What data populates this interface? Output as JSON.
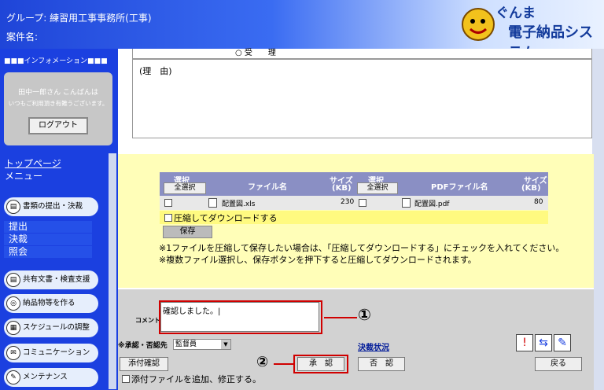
{
  "header": {
    "group": "グループ: 練習用工事事務所(工事)",
    "case": "案件名:",
    "logo_small": "ぐんま",
    "logo_big": "電子納品システム"
  },
  "sidebar": {
    "info_title": "■■■インフォメーション■■■",
    "user_greeting": "田中一郎さん こんばんは",
    "thanks": "いつもご利用頂き有難うございます。",
    "logout": "ログアウト",
    "top_link": "トップページ",
    "menu_label": "メニュー",
    "items": [
      {
        "label": "書類の提出・決裁"
      },
      {
        "label": "共有文書・検査支援"
      },
      {
        "label": "納品物等を作る"
      },
      {
        "label": "スケジュールの調整"
      },
      {
        "label": "コミュニケーション"
      },
      {
        "label": "メンテナンス"
      }
    ],
    "subitems": [
      "提出",
      "決裁",
      "照会"
    ]
  },
  "main": {
    "approve_option": "○ 受　　理",
    "reason_label": "(理　由)"
  },
  "files": {
    "headers": {
      "select": "選択",
      "select_all": "全選択",
      "file_name": "ファイル名",
      "size": "サイズ",
      "size_unit": "(KB)",
      "select2": "選択",
      "select_all2": "全選択",
      "pdf_name": "PDFファイル名",
      "size2": "サイズ",
      "size_unit2": "(KB)"
    },
    "row": {
      "file": "配置図.xls",
      "size": "230",
      "pdf": "配置図.pdf",
      "pdf_size": "80"
    },
    "zip_label": "圧縮してダウンロードする",
    "save": "保存",
    "note1": "※1ファイルを圧縮して保存したい場合は、「圧縮してダウンロードする」にチェックを入れてください。",
    "note2": "※複数ファイル選択し、保存ボタンを押下すると圧縮してダウンロードされます。"
  },
  "bottom": {
    "comment_label": "コメント",
    "comment_value": "確認しました。|",
    "callout1": "①",
    "callout2": "②",
    "approver_label": "※承認・否認先",
    "approver_value": "監督員",
    "status_link": "決裁状況",
    "attach_confirm": "添付確認",
    "approve": "承　認",
    "reject": "否　認",
    "back": "戻る",
    "attach_modify": "添付ファイルを追加、修正する。"
  },
  "colors": {
    "accent": "#1b40e0",
    "highlight": "#d00000",
    "panel": "#fffeb8"
  }
}
